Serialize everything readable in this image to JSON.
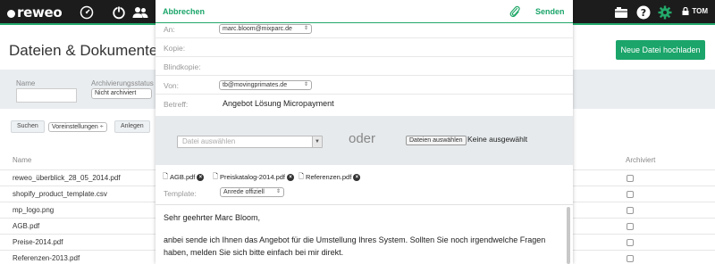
{
  "topbar": {
    "logo": "reweo",
    "user": "TOM",
    "colors": {
      "bar": "#1c1c1c",
      "accent": "#23a86a"
    },
    "icons": [
      "dashboard-icon",
      "power-icon",
      "users-icon",
      "folder-icon",
      "help-icon",
      "settings-icon",
      "lock-icon"
    ]
  },
  "page": {
    "title": "Dateien & Dokumente",
    "upload_button": "Neue Datei hochladen",
    "filter": {
      "name_label": "Name",
      "archive_label": "Archivierungsstatus",
      "archive_value": "Nicht archiviert"
    },
    "actions": {
      "search": "Suchen",
      "presets": "Voreinstellungen",
      "ask": "Anlegen"
    },
    "table": {
      "col_name": "Name",
      "col_archived": "Archiviert",
      "rows": [
        "reweo_überblick_28_05_2014.pdf",
        "shopify_product_template.csv",
        "mp_logo.png",
        "AGB.pdf",
        "Preise-2014.pdf",
        "Referenzen-2013.pdf"
      ]
    }
  },
  "compose": {
    "cancel": "Abbrechen",
    "send": "Senden",
    "fields": {
      "to_label": "An:",
      "to_value": "marc.bloom@mixparc.de",
      "cc_label": "Kopie:",
      "bcc_label": "Blindkopie:",
      "from_label": "Von:",
      "from_value": "tb@movingprimates.de",
      "subject_label": "Betreff:",
      "subject_value": "Angebot Lösung Micropayment"
    },
    "attach": {
      "choose_placeholder": "Datei auswählen",
      "or": "oder",
      "browse_button": "Dateien auswählen",
      "none_selected": "Keine ausgewählt",
      "files": [
        "AGB.pdf",
        "Preiskatalog-2014.pdf",
        "Referenzen.pdf"
      ]
    },
    "template": {
      "label": "Template:",
      "value": "Anrede offiziell"
    },
    "body": {
      "line1": "Sehr geehrter Marc Bloom,",
      "line2": "anbei sende ich Ihnen das Angebot für die Umstellung Ihres System. Sollten Sie noch irgendwelche Fragen",
      "line3": "haben, melden Sie sich bitte einfach bei mir direkt."
    }
  }
}
